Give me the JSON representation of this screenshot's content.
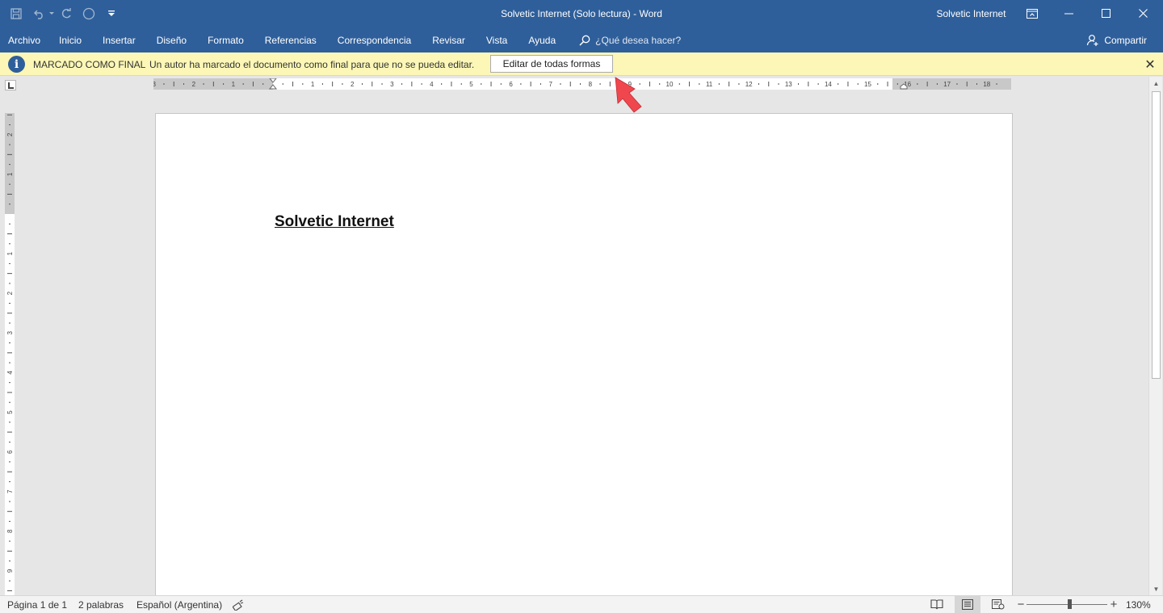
{
  "window": {
    "title": "Solvetic Internet (Solo lectura)  -  Word",
    "user": "Solvetic Internet"
  },
  "icons": {
    "qat": [
      "save-icon",
      "undo-icon",
      "undo-dropdown-icon",
      "redo-icon",
      "touch-mode-icon",
      "customize-qat-icon"
    ],
    "window": [
      "ribbon-display-icon",
      "minimize-icon",
      "maximize-icon",
      "close-icon"
    ]
  },
  "ribbon": {
    "tabs": [
      "Archivo",
      "Inicio",
      "Insertar",
      "Diseño",
      "Formato",
      "Referencias",
      "Correspondencia",
      "Revisar",
      "Vista",
      "Ayuda"
    ],
    "tell_me_placeholder": "¿Qué desea hacer?",
    "share_label": "Compartir"
  },
  "message_bar": {
    "title": "MARCADO COMO FINAL",
    "text": "Un autor ha marcado el documento como final para que no se pueda editar.",
    "button_label": "Editar de todas formas",
    "close_glyph": "✕",
    "info_glyph": "i"
  },
  "ruler": {
    "left_labels": [
      "3",
      "2",
      "1"
    ],
    "right_labels": [
      "1",
      "2",
      "3",
      "4",
      "5",
      "6",
      "7",
      "8",
      "9",
      "10",
      "11",
      "12",
      "13",
      "14",
      "15",
      "16",
      "17",
      "18"
    ],
    "vertical_top_labels": [
      "2",
      "1"
    ],
    "vertical_labels": [
      "1",
      "2",
      "3",
      "4",
      "5",
      "6",
      "7",
      "8",
      "9"
    ]
  },
  "document": {
    "heading": "Solvetic Internet"
  },
  "status": {
    "page": "Página 1 de 1",
    "words": "2 palabras",
    "language": "Español (Argentina)",
    "zoom_minus": "−",
    "zoom_plus": "+",
    "zoom_level": "130%"
  },
  "colors": {
    "title_bar": "#2f5f9a",
    "message_bar": "#fcf7b6",
    "annotation_arrow": "#f0474f"
  }
}
